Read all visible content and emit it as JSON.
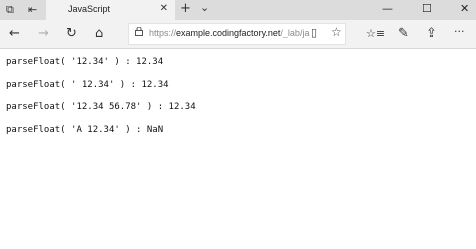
{
  "tab": {
    "title": "JavaScript"
  },
  "address_bar": {
    "url_prefix": "https://",
    "url_domain": "example.codingfactory.net",
    "url_path": "/_lab/ja"
  },
  "output_lines": [
    "parseFloat( '12.34' ) : 12.34",
    "parseFloat( ' 12.34' ) : 12.34",
    "parseFloat( '12.34 56.78' ) : 12.34",
    "parseFloat( 'A 12.34' ) : NaN"
  ],
  "icons": {
    "tabs_aside": "⧉",
    "tab_preview": "⇤",
    "close": "✕",
    "new_tab": "+",
    "tab_list": "⌄",
    "minimize": "—",
    "maximize": "☐",
    "window_close": "✕",
    "back": "←",
    "forward": "→",
    "refresh": "↻",
    "home": "⌂",
    "reading_view": "▯",
    "favorite": "☆",
    "favorites_hub": "☆≡",
    "notes": "✎",
    "share": "⇪",
    "more": "···"
  }
}
